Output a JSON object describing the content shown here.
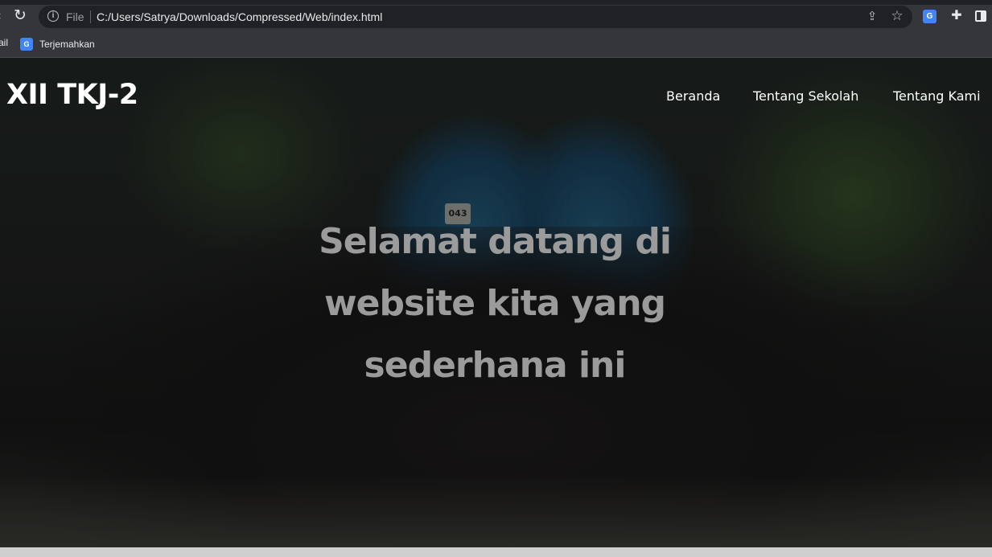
{
  "browser": {
    "file_label": "File",
    "url": "C:/Users/Satrya/Downloads/Compressed/Web/index.html",
    "icons": {
      "back": "arrow-left",
      "reload": "reload-icon",
      "info": "info-icon",
      "share": "share-icon",
      "bookmark": "star-icon",
      "translate": "google-translate-icon",
      "extensions": "puzzle-icon",
      "side_panel": "side-panel-icon"
    }
  },
  "bookmarks_bar": {
    "partial_item": "ail",
    "items": [
      {
        "label": "Terjemahkan",
        "icon": "google-translate-icon"
      }
    ]
  },
  "site": {
    "brand": "XII TKJ-2",
    "nav": [
      {
        "label": "Beranda"
      },
      {
        "label": "Tentang Sekolah"
      },
      {
        "label": "Tentang Kami"
      }
    ],
    "hero_text": "Selamat datang di website kita yang sederhana ini",
    "hero_photo_sign": "043",
    "colors": {
      "browser_bg": "#35363a",
      "omnibox_bg": "#202124",
      "hero_text": "#9b9b9b",
      "nav_text": "#ffffff"
    }
  }
}
